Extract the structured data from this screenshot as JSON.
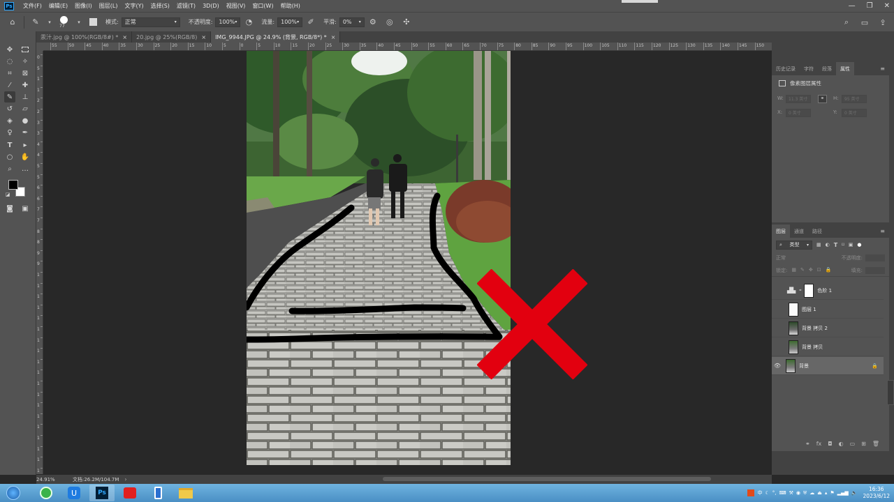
{
  "app": {
    "logo": "Ps"
  },
  "menu": [
    "文件(F)",
    "编辑(E)",
    "图像(I)",
    "图层(L)",
    "文字(Y)",
    "选择(S)",
    "滤镜(T)",
    "3D(D)",
    "视图(V)",
    "窗口(W)",
    "帮助(H)"
  ],
  "window_controls": {
    "minimize": "—",
    "restore": "❐",
    "close": "✕"
  },
  "options": {
    "brush_size": "77",
    "mode_label": "模式:",
    "mode_value": "正常",
    "opacity_label": "不透明度:",
    "opacity_value": "100%",
    "flow_label": "流量:",
    "flow_value": "100%",
    "smoothing_label": "平滑:",
    "smoothing_value": "0%"
  },
  "tabs": [
    {
      "label": "汞汁.jpg @ 100%(RGB/8#) *",
      "close": "×",
      "active": false
    },
    {
      "label": "20.jpg @ 25%(RGB/8)",
      "close": "×",
      "active": false
    },
    {
      "label": "IMG_9944.JPG @ 24.9% (背景, RGB/8*) *",
      "close": "×",
      "active": true
    }
  ],
  "ruler_top": [
    "55",
    "50",
    "45",
    "40",
    "35",
    "30",
    "25",
    "20",
    "15",
    "10",
    "5",
    "0",
    "5",
    "10",
    "15",
    "20",
    "25",
    "30",
    "35",
    "40",
    "45",
    "50",
    "55",
    "60",
    "65",
    "70",
    "75",
    "80",
    "85",
    "90",
    "95",
    "100",
    "105",
    "110",
    "115",
    "120",
    "125",
    "130",
    "135",
    "140",
    "145",
    "150"
  ],
  "ruler_left": [
    "0",
    "5",
    "1",
    "1",
    "2",
    "2",
    "3",
    "3",
    "4",
    "4",
    "5",
    "5",
    "6",
    "6",
    "7",
    "7",
    "8",
    "8",
    "9",
    "9",
    "1",
    "1",
    "1",
    "1",
    "1",
    "1",
    "1",
    "1",
    "1",
    "1",
    "1",
    "1",
    "1",
    "1",
    "1",
    "1",
    "1",
    "1",
    "1"
  ],
  "properties": {
    "tabs": [
      "历史记录",
      "字符",
      "段落",
      "属性"
    ],
    "active_tab": "属性",
    "title": "像素图层属性",
    "w_label": "W:",
    "w_value": "11.3 英寸",
    "h_label": "H:",
    "h_value": "95 英寸",
    "x_label": "X:",
    "x_value": "0 英寸",
    "y_label": "Y:",
    "y_value": "0 英寸"
  },
  "layers": {
    "tabs": [
      "图层",
      "通道",
      "路径"
    ],
    "active_tab": "图层",
    "filter_label": "类型",
    "blend_mode": "正常",
    "opacity_label": "不透明度:",
    "lock_label": "锁定:",
    "fill_label": "填充:",
    "items": [
      {
        "name": "色阶 1",
        "visible": false,
        "type": "adjustment"
      },
      {
        "name": "图层 1",
        "visible": false,
        "type": "white"
      },
      {
        "name": "背景 拷贝 2",
        "visible": false,
        "type": "photo"
      },
      {
        "name": "背景 拷贝",
        "visible": false,
        "type": "photo"
      },
      {
        "name": "背景",
        "visible": true,
        "type": "photo",
        "selected": true,
        "locked": true
      }
    ]
  },
  "status": {
    "zoom": "24.91%",
    "doc": "文档:26.2M/104.7M"
  },
  "taskbar": {
    "time": "16:36",
    "date": "2023/6/12",
    "tray_text": "中"
  },
  "colors": {
    "red_cross": "#e2000f",
    "stroke": "#000000",
    "canvas_bg": "#282828",
    "panel_bg": "#535353"
  }
}
